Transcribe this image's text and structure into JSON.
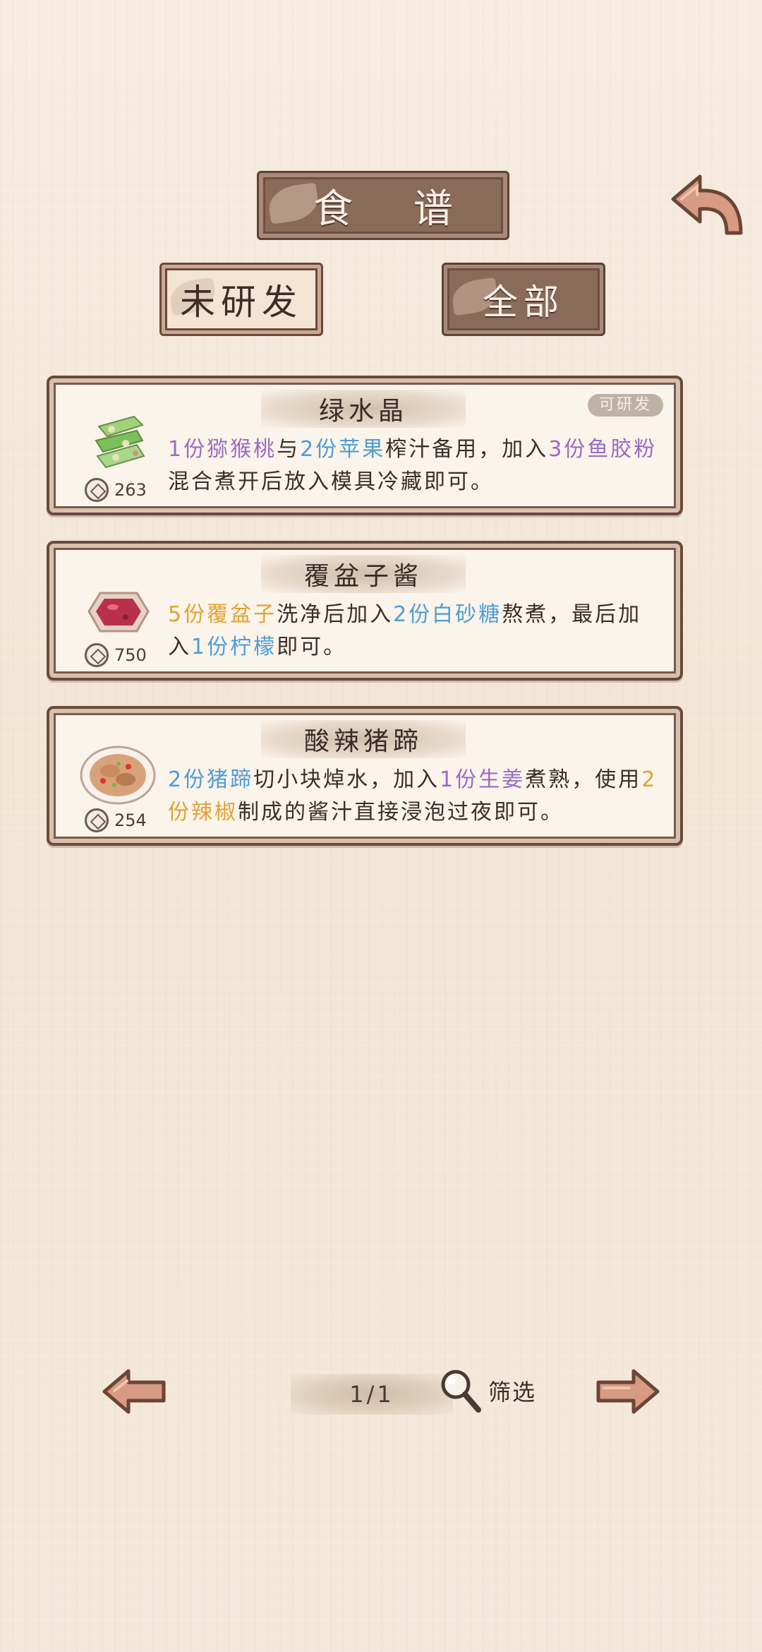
{
  "header": {
    "title": "食 谱",
    "back_icon": "back-arrow-icon"
  },
  "tabs": [
    {
      "label": "未研发",
      "active": false
    },
    {
      "label": "全部",
      "active": true
    }
  ],
  "recipes": [
    {
      "name": "绿水晶",
      "badge": "可研发",
      "price": "263",
      "icon": "green-jelly-icon",
      "desc": [
        {
          "t": "1份猕猴桃",
          "c": "purple"
        },
        {
          "t": "与",
          "c": ""
        },
        {
          "t": "2份苹果",
          "c": "blue"
        },
        {
          "t": "榨汁备用，加入",
          "c": ""
        },
        {
          "t": "3份鱼胶粉",
          "c": "purple"
        },
        {
          "t": "混合煮开后放入模具冷藏即可。",
          "c": ""
        }
      ]
    },
    {
      "name": "覆盆子酱",
      "badge": "",
      "price": "750",
      "icon": "raspberry-jam-icon",
      "desc": [
        {
          "t": "5份覆盆子",
          "c": "orange"
        },
        {
          "t": "洗净后加入",
          "c": ""
        },
        {
          "t": "2份白砂糖",
          "c": "blue"
        },
        {
          "t": "熬煮，最后加入",
          "c": ""
        },
        {
          "t": "1份柠檬",
          "c": "blue"
        },
        {
          "t": "即可。",
          "c": ""
        }
      ]
    },
    {
      "name": "酸辣猪蹄",
      "badge": "",
      "price": "254",
      "icon": "spicy-pork-trotter-icon",
      "desc": [
        {
          "t": "2份猪蹄",
          "c": "blue"
        },
        {
          "t": "切小块焯水，加入",
          "c": ""
        },
        {
          "t": "1份生姜",
          "c": "purple"
        },
        {
          "t": "煮熟，使用",
          "c": ""
        },
        {
          "t": "2份辣椒",
          "c": "orange"
        },
        {
          "t": "制成的酱汁直接浸泡过夜即可。",
          "c": ""
        }
      ]
    }
  ],
  "pagination": {
    "page": "1/1",
    "filter_label": "筛选"
  },
  "colors": {
    "highlight_purple": "#9a6bc4",
    "highlight_blue": "#4d9cd6",
    "highlight_orange": "#e2a233",
    "plaque_brown": "#8a6a58",
    "frame_brown": "#6a4a3e"
  }
}
